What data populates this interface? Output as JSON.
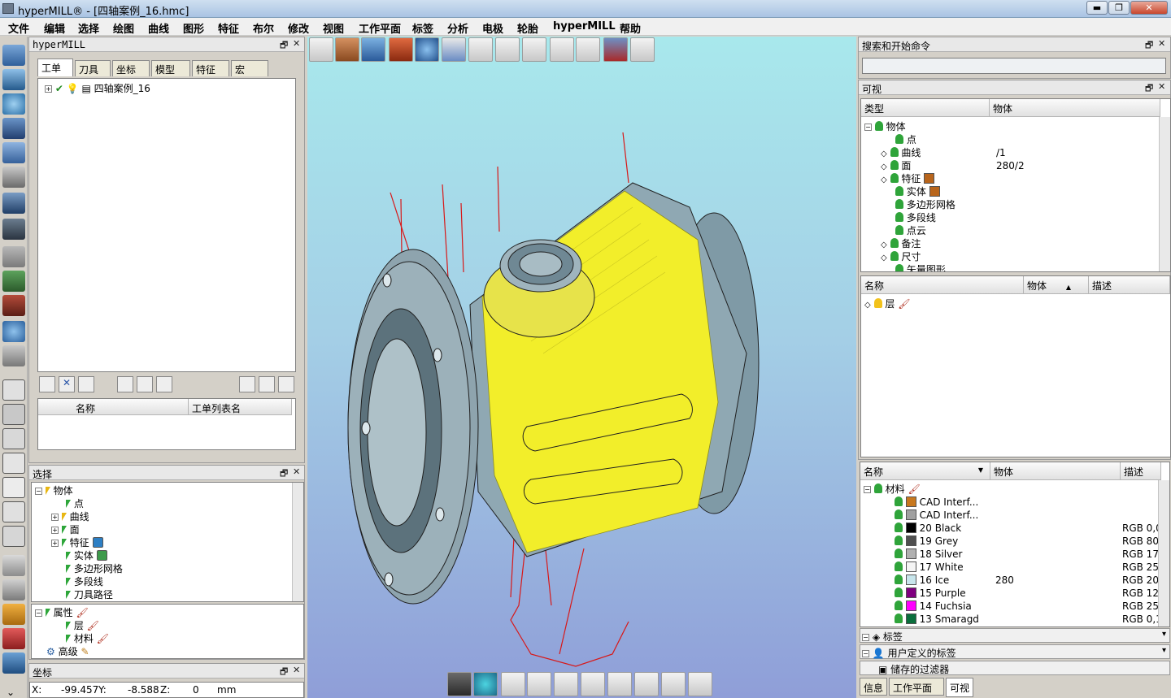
{
  "window": {
    "title": "hyperMILL® - [四轴案例_16.hmc]",
    "min": "▬",
    "max": "❐",
    "close": "✕"
  },
  "menu": [
    "文件",
    "编辑",
    "选择",
    "绘图",
    "曲线",
    "图形",
    "特征",
    "布尔",
    "修改",
    "视图",
    "工作平面",
    "标签",
    "分析",
    "电极",
    "轮胎",
    "hyperMILL",
    "帮助"
  ],
  "hm_panel": {
    "title": "hyperMILL",
    "tabs": [
      "工单",
      "刀具",
      "坐标",
      "模型",
      "特征",
      "宏"
    ],
    "tree_item": "四轴案例_16",
    "list_cols": [
      "名称",
      "工单列表名"
    ]
  },
  "select_panel": {
    "title": "选择",
    "items": [
      "物体",
      "点",
      "曲线",
      "面",
      "特征",
      "实体",
      "多边形网格",
      "多段线",
      "刀具路径"
    ],
    "props": [
      "属性",
      "层",
      "材料",
      "高级"
    ]
  },
  "coord_panel": {
    "title": "坐标",
    "x_label": "X:",
    "x": "-99.457",
    "y_label": "Y:",
    "y": "-8.588",
    "z_label": "Z:",
    "z": "0",
    "unit": "mm"
  },
  "search_panel": {
    "title": "搜索和开始命令",
    "placeholder": ""
  },
  "visible_panel": {
    "title": "可视",
    "cols": [
      "类型",
      "物体"
    ],
    "rows": [
      {
        "label": "物体",
        "count": ""
      },
      {
        "label": "点",
        "count": ""
      },
      {
        "label": "曲线",
        "count": "/1"
      },
      {
        "label": "面",
        "count": "280/2"
      },
      {
        "label": "特征",
        "count": ""
      },
      {
        "label": "实体",
        "count": ""
      },
      {
        "label": "多边形网格",
        "count": ""
      },
      {
        "label": "多段线",
        "count": ""
      },
      {
        "label": "点云",
        "count": ""
      },
      {
        "label": "备注",
        "count": ""
      },
      {
        "label": "尺寸",
        "count": ""
      },
      {
        "label": "矢量图形",
        "count": ""
      }
    ],
    "layer_cols": [
      "名称",
      "物体",
      "描述"
    ],
    "layer_sort": "▲",
    "layer_row": "层"
  },
  "material_panel": {
    "cols": [
      "名称",
      "物体",
      "描述"
    ],
    "sort": "▼",
    "root": "材料",
    "rows": [
      {
        "name": "CAD Interf...",
        "count": "",
        "desc": "",
        "color": "#c8781e"
      },
      {
        "name": "CAD Interf...",
        "count": "",
        "desc": "",
        "color": "#a0a0a0"
      },
      {
        "name": "20 Black",
        "count": "",
        "desc": "RGB 0,0",
        "color": "#000000"
      },
      {
        "name": "19 Grey",
        "count": "",
        "desc": "RGB 80,",
        "color": "#505050"
      },
      {
        "name": "18 Silver",
        "count": "",
        "desc": "RGB 17(",
        "color": "#b0b0b0"
      },
      {
        "name": "17 White",
        "count": "",
        "desc": "RGB 25!",
        "color": "#f5f5f5"
      },
      {
        "name": "16 Ice",
        "count": "280",
        "desc": "RGB 20:",
        "color": "#c8e6ec"
      },
      {
        "name": "15 Purple",
        "count": "",
        "desc": "RGB 128",
        "color": "#800080"
      },
      {
        "name": "14 Fuchsia",
        "count": "",
        "desc": "RGB 25!",
        "color": "#ff00ff"
      },
      {
        "name": "13 Smaragd",
        "count": "",
        "desc": "RGB 0,1",
        "color": "#0a6e3c"
      }
    ]
  },
  "collapsed": [
    "标签",
    "用户定义的标签",
    "储存的过滤器"
  ],
  "bottom_tabs": [
    "信息",
    "工作平面",
    "可视"
  ]
}
